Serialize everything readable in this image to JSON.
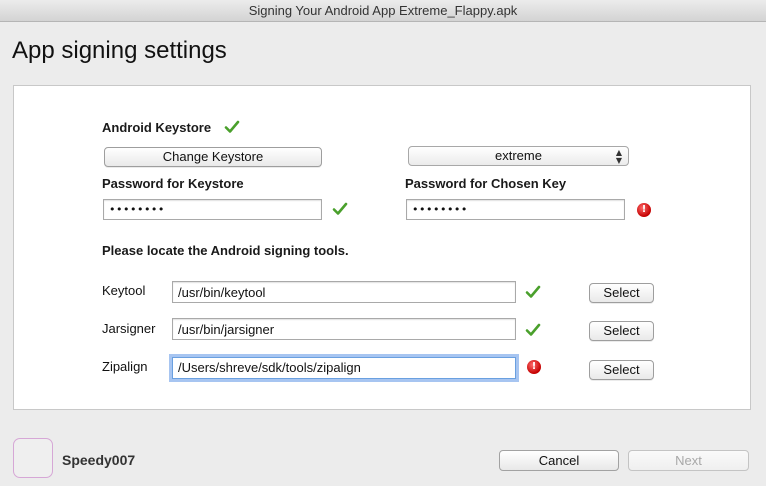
{
  "window": {
    "title": "Signing Your Android App Extreme_Flappy.apk"
  },
  "page": {
    "title": "App signing settings"
  },
  "keystore": {
    "heading": "Android Keystore",
    "change_button": "Change Keystore",
    "key_alias_selected": "extreme",
    "password_label": "Password for Keystore",
    "password_value": "••••••••",
    "key_password_label": "Password for Chosen Key",
    "key_password_value": "••••••••"
  },
  "tools": {
    "instructions": "Please locate the Android signing tools.",
    "rows": [
      {
        "label": "Keytool",
        "path": "/usr/bin/keytool",
        "select_label": "Select",
        "status": "ok"
      },
      {
        "label": "Jarsigner",
        "path": "/usr/bin/jarsigner",
        "select_label": "Select",
        "status": "ok"
      },
      {
        "label": "Zipalign",
        "path": "/Users/shreve/sdk/tools/zipalign",
        "select_label": "Select",
        "status": "error"
      }
    ]
  },
  "footer": {
    "username": "Speedy007",
    "cancel_label": "Cancel",
    "next_label": "Next"
  },
  "icons": {
    "ok": "checkmark-icon",
    "error": "error-icon",
    "error_glyph": "!"
  },
  "colors": {
    "ok_green": "#4aa02c",
    "error_red": "#d00000",
    "focus_blue": "#6aa0e0"
  }
}
